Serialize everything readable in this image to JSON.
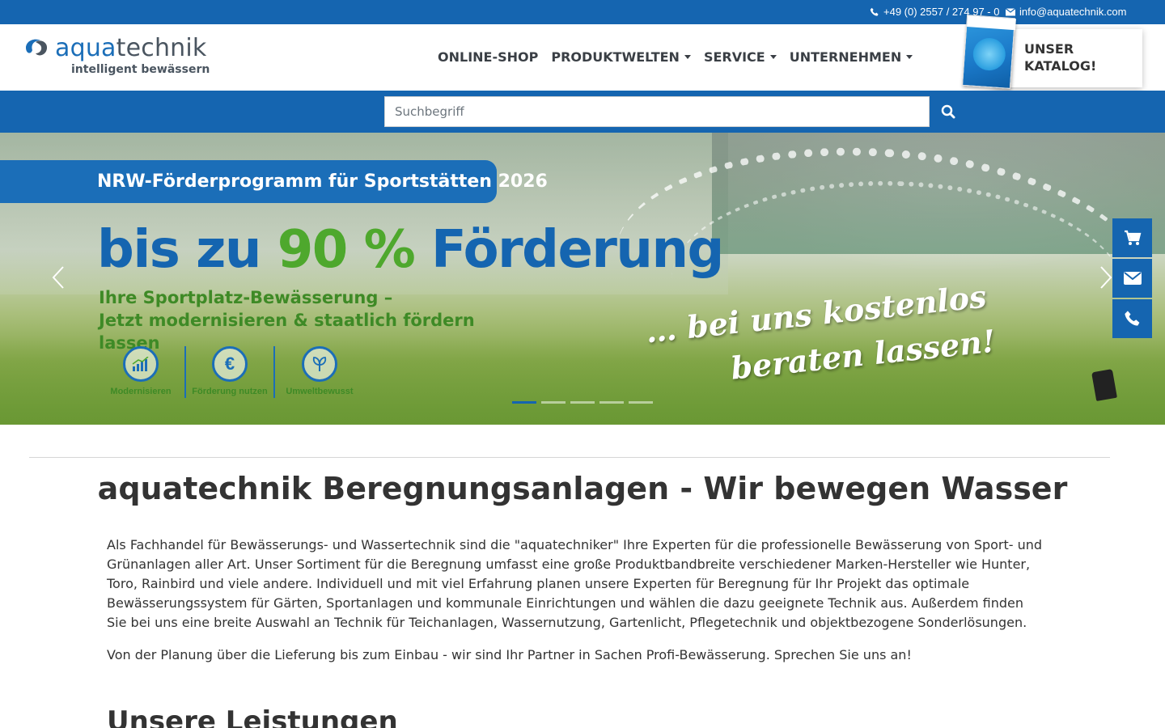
{
  "topbar": {
    "phone": "+49 (0) 2557 / 274 97 - 0",
    "email": "info@aquatechnik.com",
    "background": "#1565b0"
  },
  "logo": {
    "brand_prefix": "aqua",
    "brand_suffix": "technik",
    "tagline": "intelligent bewässern"
  },
  "nav": {
    "items": [
      {
        "label": "ONLINE-SHOP",
        "dropdown": false
      },
      {
        "label": "PRODUKTWELTEN",
        "dropdown": true
      },
      {
        "label": "SERVICE",
        "dropdown": true
      },
      {
        "label": "UNTERNEHMEN",
        "dropdown": true
      }
    ]
  },
  "catalog": {
    "label": "UNSER KATALOG!"
  },
  "search": {
    "placeholder": "Suchbegriff",
    "button_icon": "search-icon"
  },
  "hero": {
    "tag": "NRW-Förderprogramm für Sportstätten 2026",
    "headline_a": "bis zu ",
    "headline_b": "90 %",
    "headline_c": " Förderung",
    "subline_1": "Ihre Sportplatz-Bewässerung –",
    "subline_2": "Jetzt modernisieren & staatlich fördern lassen",
    "features": [
      {
        "label": "Modernisieren",
        "icon": "chart-icon"
      },
      {
        "label": "Förderung nutzen",
        "icon": "euro-icon"
      },
      {
        "label": "Umweltbewusst",
        "icon": "leaf-icon"
      }
    ],
    "slogan_1": "… bei uns kostenlos",
    "slogan_2": "beraten lassen!",
    "slides_total": 5,
    "active_slide": 1
  },
  "side_actions": [
    {
      "icon": "cart-icon"
    },
    {
      "icon": "envelope-icon"
    },
    {
      "icon": "phone-icon"
    }
  ],
  "content": {
    "title": "aquatechnik Beregnungsanlagen - Wir bewegen Wasser",
    "intro": "Als Fachhandel für Bewässerungs- und Wassertechnik sind die \"aquatechniker\" Ihre Experten für die professionelle Bewässerung von Sport- und Grünanlagen aller Art. Unser Sortiment für die Beregnung umfasst eine große Produktbandbreite verschiedener Marken-Hersteller wie Hunter, Toro, Rainbird und viele andere.  Individuell und mit viel Erfahrung planen unsere Experten für Beregnung für Ihr Projekt das optimale Bewässerungssystem für Gärten, Sportanlagen und kommunale Einrichtungen und wählen die dazu geeignete Technik aus. Außerdem finden Sie bei uns eine breite Auswahl an Technik für Teichanlagen, Wassernutzung, Gartenlicht, Pflegetechnik und objektbezogene Sonderlösungen.",
    "intro2": "Von der Planung über die Lieferung bis zum Einbau - wir sind Ihr Partner in Sachen Profi-Bewässerung. Sprechen Sie uns an!",
    "section_title": "Unsere Leistungen"
  }
}
